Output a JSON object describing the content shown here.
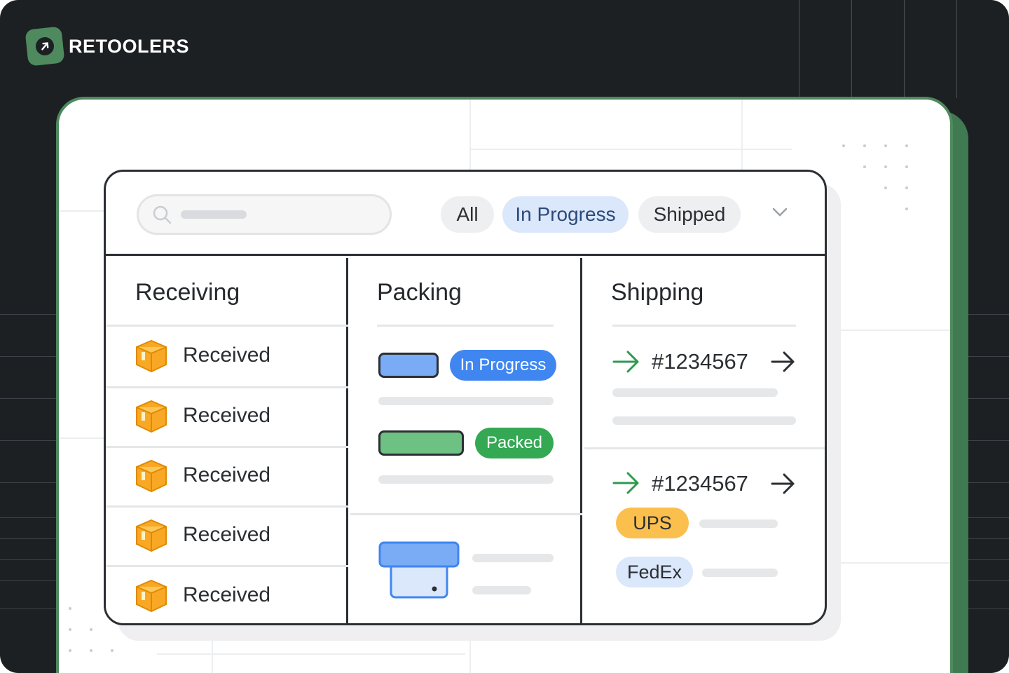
{
  "brand": {
    "name": "RETOOLERS",
    "accent": "#4e8a5e"
  },
  "toolbar": {
    "search_placeholder": "",
    "filters": [
      {
        "label": "All",
        "active": false
      },
      {
        "label": "In Progress",
        "active": true
      },
      {
        "label": "Shipped",
        "active": false
      }
    ],
    "dropdown_icon": "chevron-down-icon"
  },
  "columns": {
    "receiving": {
      "title": "Receiving",
      "items": [
        {
          "label": "Received",
          "icon": "box-icon"
        },
        {
          "label": "Received",
          "icon": "box-icon"
        },
        {
          "label": "Received",
          "icon": "box-icon"
        },
        {
          "label": "Received",
          "icon": "box-icon"
        },
        {
          "label": "Received",
          "icon": "box-icon"
        }
      ]
    },
    "packing": {
      "title": "Packing",
      "statuses": [
        {
          "label": "In Progress",
          "color": "#3f86f0"
        },
        {
          "label": "Packed",
          "color": "#34a853"
        }
      ]
    },
    "shipping": {
      "title": "Shipping",
      "shipments": [
        {
          "id": "#1234567"
        },
        {
          "id": "#1234567",
          "carriers": [
            {
              "label": "UPS",
              "color": "#fbbf4d"
            },
            {
              "label": "FedEx",
              "color": "#dbe7fb"
            }
          ]
        }
      ]
    }
  }
}
